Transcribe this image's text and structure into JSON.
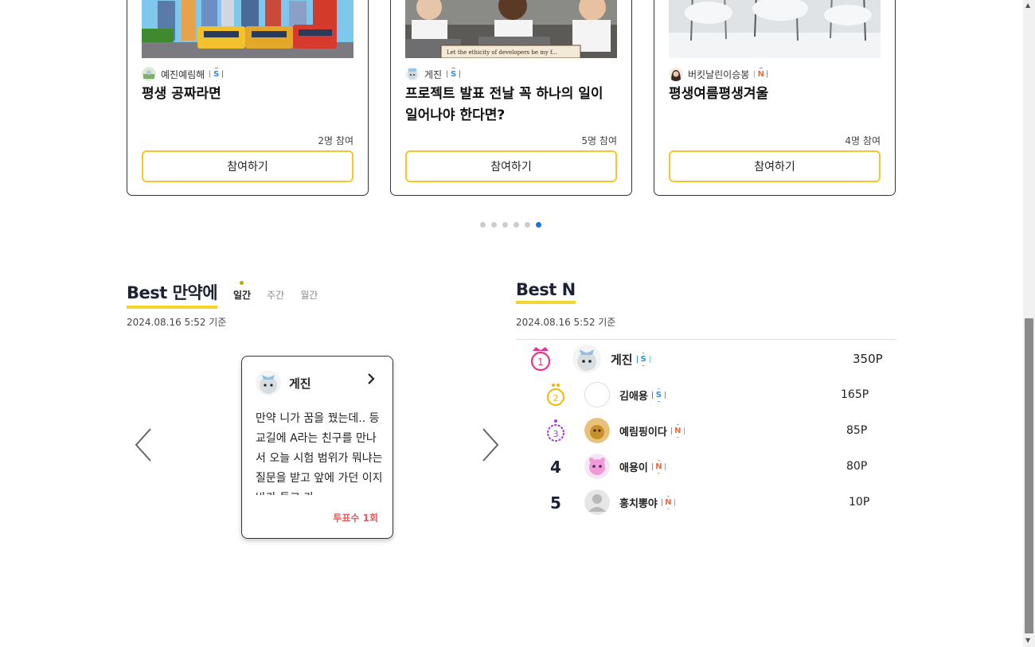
{
  "cards": [
    {
      "author": "예진예림해",
      "badge": "S",
      "title": "평생 공짜라면",
      "count": "2명 참여",
      "button": "참여하기",
      "thumb": "city-bus-illustration"
    },
    {
      "author": "게진",
      "badge": "S",
      "title": "프로젝트 발표 전날 꼭 하나의 일이 일어나야 한다면?",
      "count": "5명 참여",
      "button": "참여하기",
      "thumb": "stressed-developers-illustration"
    },
    {
      "author": "버킷날린이승봉",
      "badge": "N",
      "title": "평생여름평생겨울",
      "count": "4명 참여",
      "button": "참여하기",
      "thumb": "snowy-forest-photo"
    }
  ],
  "pagination": {
    "total": 6,
    "active": 6
  },
  "best_manyak": {
    "title": "Best 만약에",
    "tabs": [
      "일간",
      "주간",
      "월간"
    ],
    "active_tab": "일간",
    "date": "2024.08.16 5:52 기준",
    "card": {
      "author": "게진",
      "text": "만약 니가 꿈을 꿨는데.. 등교길에 A라는 친구를 만나서 오늘 시험 범위가 뭐냐는 질문을 받고 앞에 가던 이지바가 들고 가",
      "votes": "투표수 1회"
    }
  },
  "best_n": {
    "title": "Best N",
    "date": "2024.08.16 5:52 기준",
    "ranks": [
      {
        "rank": "1",
        "name": "게진",
        "badge": "S",
        "points": "350P"
      },
      {
        "rank": "2",
        "name": "김애용",
        "badge": "S",
        "points": "165P"
      },
      {
        "rank": "3",
        "name": "예림핑이다",
        "badge": "N",
        "points": "85P"
      },
      {
        "rank": "4",
        "name": "애용이",
        "badge": "N",
        "points": "80P"
      },
      {
        "rank": "5",
        "name": "홍치뽕야",
        "badge": "N",
        "points": "10P"
      }
    ]
  },
  "colors": {
    "accent_yellow": "#f5d52c",
    "active_dot": "#1976d2",
    "badge_s": "#2a8ce8",
    "badge_n": "#ee6a3c",
    "vote_red": "#e35d5d"
  }
}
